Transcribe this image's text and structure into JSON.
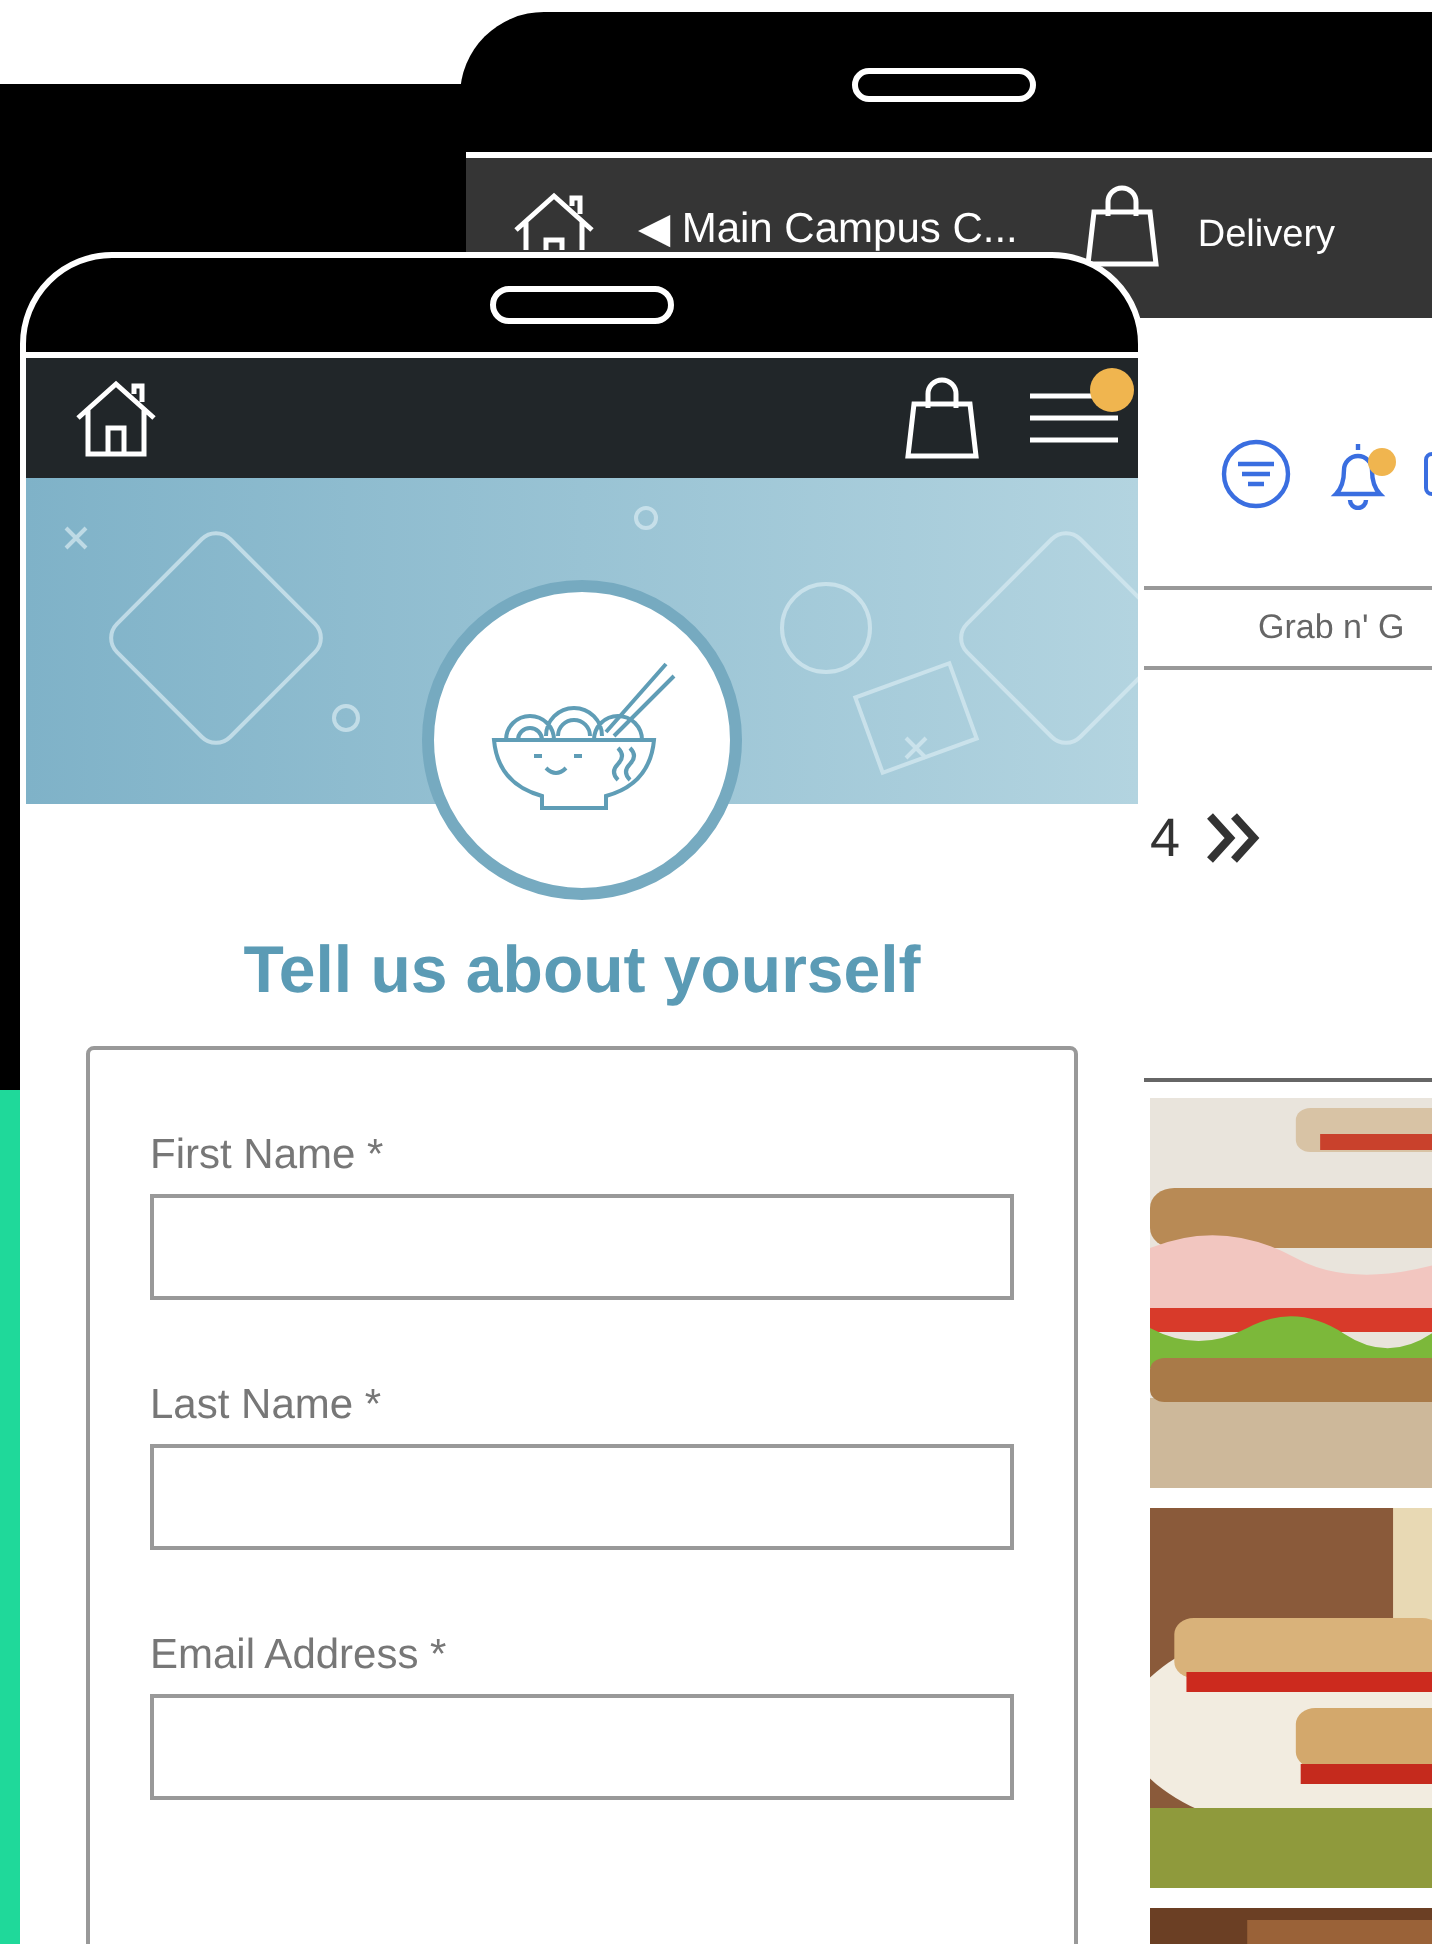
{
  "back_phone": {
    "header": {
      "location": "◀ Main Campus C...",
      "mode": "Delivery"
    },
    "notifications": {
      "unread": true
    },
    "tab": "Grab n' G",
    "page_number": "4"
  },
  "front_phone": {
    "header": {
      "menu_badge": true
    },
    "title": "Tell us about yourself",
    "fields": [
      {
        "label": "First Name *"
      },
      {
        "label": "Last Name *"
      },
      {
        "label": "Email Address *"
      }
    ]
  }
}
